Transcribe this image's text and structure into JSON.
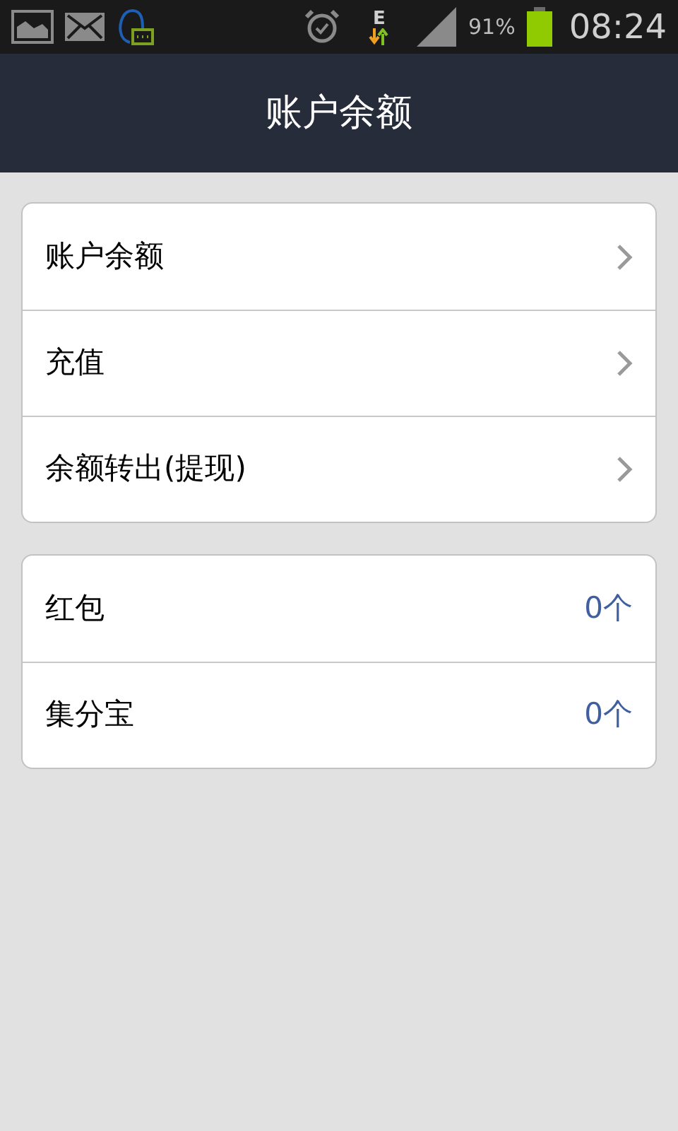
{
  "status_bar": {
    "network": "E",
    "battery": "91%",
    "time": "08:24"
  },
  "header": {
    "title": "账户余额"
  },
  "groups": [
    {
      "items": [
        {
          "kind": "link",
          "label": "账户余额"
        },
        {
          "kind": "link",
          "label": "充值"
        },
        {
          "kind": "link",
          "label": "余额转出(提现)"
        }
      ]
    },
    {
      "items": [
        {
          "kind": "count",
          "label": "红包",
          "value": "0个"
        },
        {
          "kind": "count",
          "label": "集分宝",
          "value": "0个"
        }
      ]
    }
  ]
}
